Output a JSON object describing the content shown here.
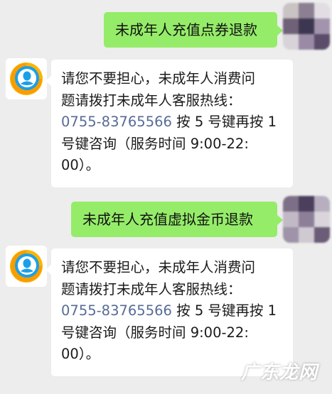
{
  "messages": [
    {
      "sender": "user",
      "text": "未成年人充值点券退款"
    },
    {
      "sender": "bot",
      "lines": [
        "请您不要担心，未成年人消费问",
        "题请拨打未成年人客服热线：",
        "按 5 号键再按 1",
        "号键咨询（服务时间 9:00-22:",
        "00）。"
      ],
      "phone": "0755-83765566"
    },
    {
      "sender": "user",
      "text": "未成年人充值虚拟金币退款"
    },
    {
      "sender": "bot",
      "lines": [
        "请您不要担心，未成年人消费问",
        "题请拨打未成年人客服热线：",
        "按 5 号键再按 1",
        "号键咨询（服务时间 9:00-22:",
        "00）。"
      ],
      "phone": "0755-83765566"
    }
  ],
  "watermark": "广东龙网",
  "colors": {
    "background": "#ededed",
    "outgoing_bubble": "#95ec69",
    "incoming_bubble": "#ffffff",
    "phone_link": "#576b95"
  },
  "icons": {
    "bot_avatar": "qq-customer-service-icon",
    "user_avatar": "blurred-avatar"
  }
}
